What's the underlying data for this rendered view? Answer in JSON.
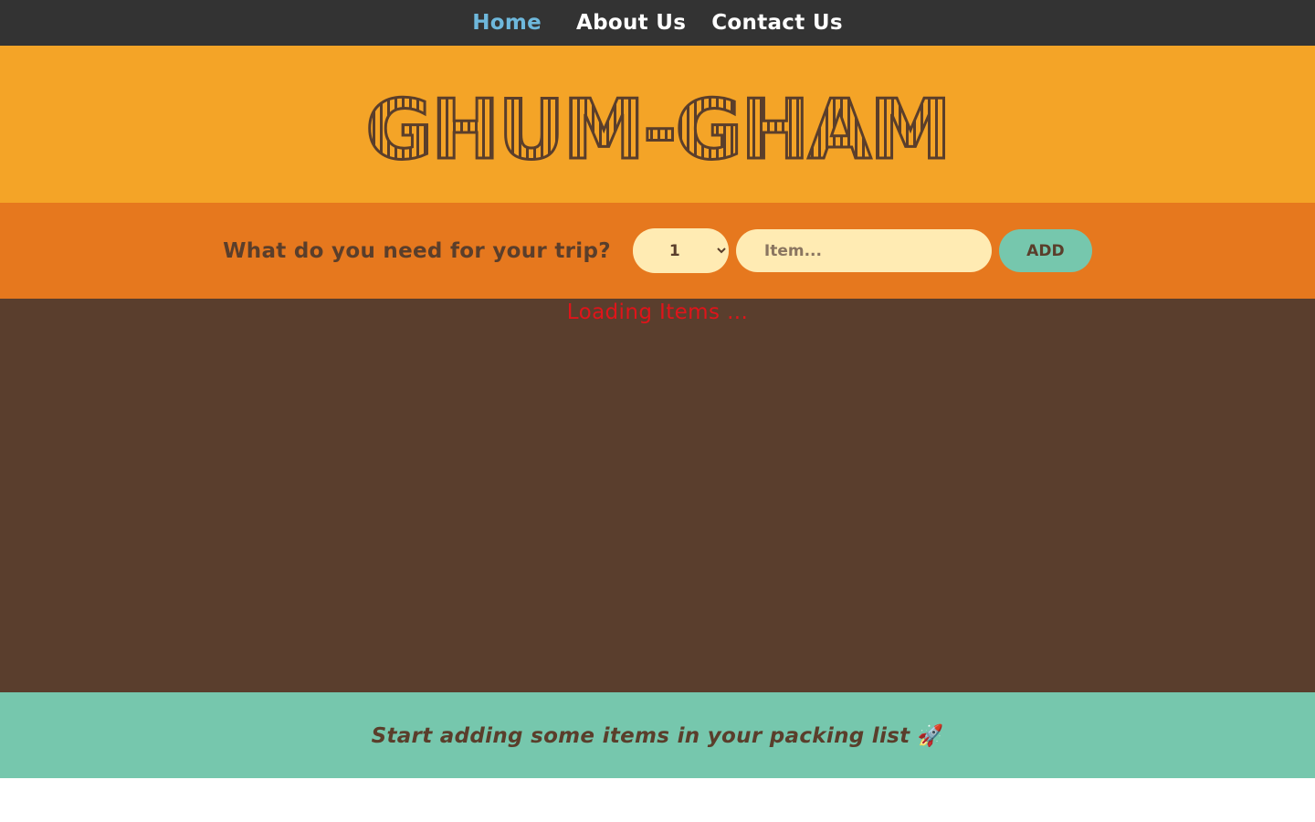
{
  "nav": {
    "items": [
      {
        "label": "Home"
      },
      {
        "label": "About Us"
      },
      {
        "label": "Contact Us"
      }
    ]
  },
  "header": {
    "logo_text": "GHUM-GHAM"
  },
  "form": {
    "question": "What do you need for your trip?",
    "quantity_selected": "1",
    "item_placeholder": "Item...",
    "add_label": "ADD"
  },
  "list": {
    "loading_text": "Loading Items ..."
  },
  "footer": {
    "stats_text": "Start adding some items in your packing list",
    "icon": "rocket-icon"
  },
  "colors": {
    "nav_bg": "#333333",
    "nav_active": "#6eb8dc",
    "header_bg": "#f4a427",
    "form_bg": "#e6781e",
    "list_bg": "#5a3e2d",
    "stats_bg": "#76c7ad",
    "input_bg": "#ffebb3",
    "loading_text": "#e0141a",
    "brand_brown": "#5a3e2b"
  }
}
